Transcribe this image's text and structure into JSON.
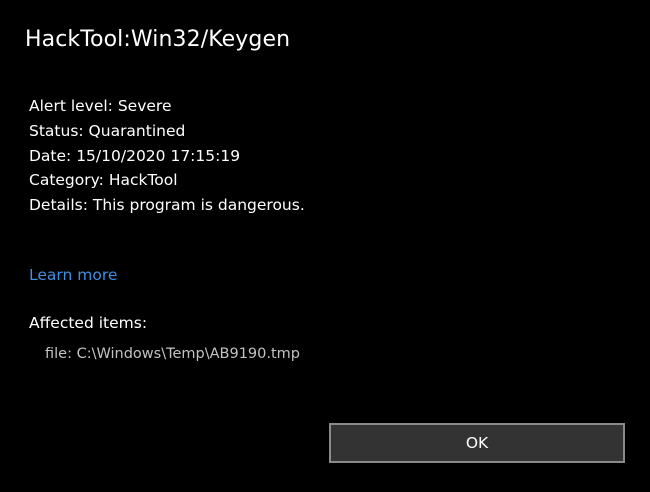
{
  "dialog": {
    "title": "HackTool:Win32/Keygen"
  },
  "details": {
    "alert_level": "Alert level: Severe",
    "status": "Status: Quarantined",
    "date": "Date: 15/10/2020 17:15:19",
    "category": "Category: HackTool",
    "details": "Details: This program is dangerous."
  },
  "links": {
    "learn_more": "Learn more"
  },
  "affected": {
    "label": "Affected items:",
    "items": [
      "file: C:\\Windows\\Temp\\AB9190.tmp"
    ]
  },
  "buttons": {
    "ok": "OK"
  },
  "colors": {
    "background": "#000000",
    "text": "#ffffff",
    "link": "#3f8ee0",
    "muted": "#c2c2c2",
    "button_bg": "#333333",
    "button_border": "#8a8a8a"
  }
}
